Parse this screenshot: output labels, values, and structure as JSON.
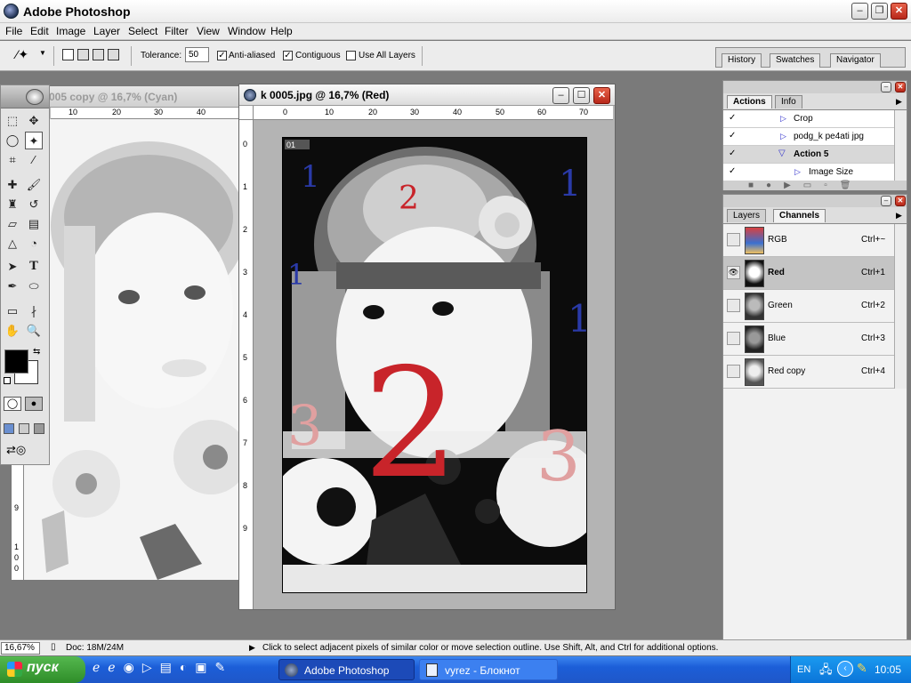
{
  "app": {
    "title": "Adobe Photoshop"
  },
  "menu": [
    "File",
    "Edit",
    "Image",
    "Layer",
    "Select",
    "Filter",
    "View",
    "Window",
    "Help"
  ],
  "options": {
    "tolerance_label": "Tolerance:",
    "tolerance_value": "50",
    "anti_aliased": "Anti-aliased",
    "contiguous": "Contiguous",
    "use_all_layers": "Use All Layers"
  },
  "palette_well": {
    "tabs": [
      "History",
      "Swatches",
      "Navigator"
    ]
  },
  "doc_back": {
    "title": "005 copy @ 16,7% (Cyan)",
    "ruler_top": [
      "10",
      "20",
      "30",
      "40"
    ],
    "ruler_left": [
      "9",
      "1",
      "0",
      "0"
    ]
  },
  "doc_front": {
    "title": "k 0005.jpg @ 16,7% (Red)",
    "ruler_top": [
      "0",
      "10",
      "20",
      "30",
      "40",
      "50",
      "60",
      "70"
    ],
    "ruler_left": [
      "0",
      "1",
      "2",
      "3",
      "4",
      "5",
      "6",
      "7",
      "8",
      "9"
    ],
    "snapshot_label": "01"
  },
  "actions_panel": {
    "tabs": [
      "Actions",
      "Info"
    ],
    "items": [
      {
        "label": "Crop",
        "indent": 1
      },
      {
        "label": "podg_k pe4ati jpg",
        "indent": 1
      },
      {
        "label": "Action 5",
        "indent": 0,
        "bold": true
      },
      {
        "label": "Image Size",
        "indent": 2
      }
    ]
  },
  "layers_panel": {
    "tabs": [
      "Layers",
      "Channels"
    ],
    "channels": [
      {
        "name": "RGB",
        "shortcut": "Ctrl+~",
        "selected": false,
        "visible": false
      },
      {
        "name": "Red",
        "shortcut": "Ctrl+1",
        "selected": true,
        "visible": true
      },
      {
        "name": "Green",
        "shortcut": "Ctrl+2",
        "selected": false,
        "visible": false
      },
      {
        "name": "Blue",
        "shortcut": "Ctrl+3",
        "selected": false,
        "visible": false
      },
      {
        "name": "Red copy",
        "shortcut": "Ctrl+4",
        "selected": false,
        "visible": false
      }
    ]
  },
  "status": {
    "zoom": "16,67%",
    "doc": "Doc: 18M/24M",
    "hint": "Click to select adjacent pixels of similar color or move selection outline.  Use Shift, Alt, and Ctrl for additional options."
  },
  "taskbar": {
    "start": "пуск",
    "tasks": [
      "Adobe Photoshop",
      "vyrez - Блокнот"
    ],
    "lang": "EN",
    "time": "10:05"
  },
  "annotations": [
    "1",
    "1",
    "1",
    "1",
    "2",
    "2",
    "3",
    "3"
  ],
  "colors": {
    "accent": "#0a246a",
    "close": "#c0321e",
    "taskbar": "#245edb",
    "start": "#3c9a35",
    "ann_blue": "#2a3aa8",
    "ann_red": "#c8242a",
    "ann_pink": "#e0a0a0"
  }
}
